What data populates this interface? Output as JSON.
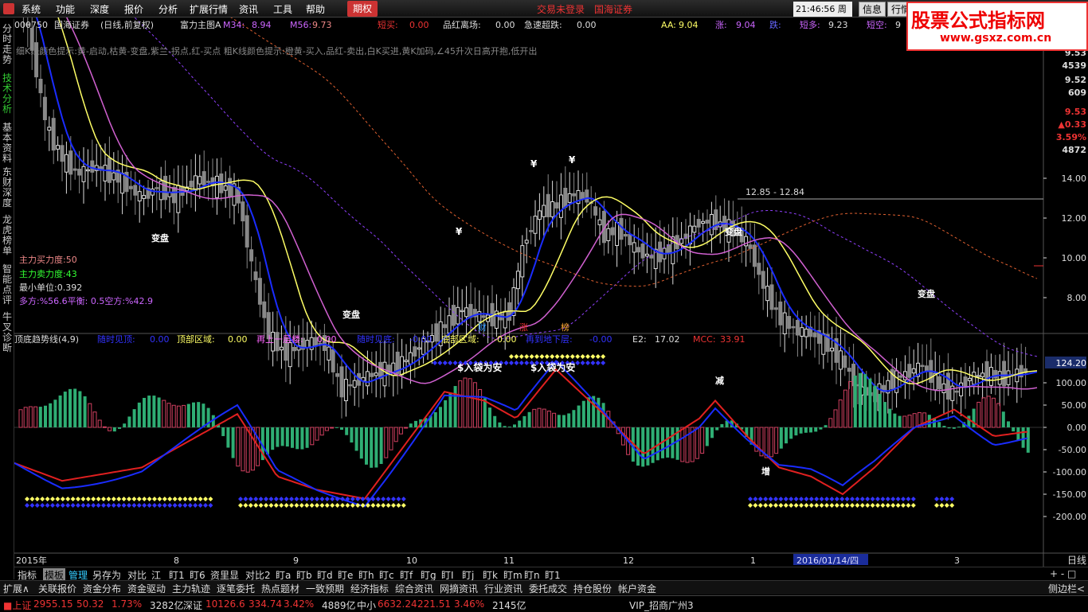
{
  "menu": {
    "items": [
      "系统",
      "功能",
      "深度",
      "报价",
      "分析",
      "扩展行情",
      "资讯",
      "工具",
      "帮助"
    ],
    "qiquan": "期权",
    "trade_status": "交易未登录",
    "broker": "国海证券",
    "time": "21:46:56 周日",
    "info": "信息",
    "market": "行情"
  },
  "watermark": {
    "title": "股票公式指标网",
    "url": "www.gsxz.com.cn"
  },
  "sidebar": {
    "tabs": [
      "分时走势",
      "技术分析",
      "基本资料",
      "东财深度",
      "龙虎榜单",
      "智能点评",
      "牛叉诊断"
    ]
  },
  "header": {
    "code": "000750",
    "name": "国海证券",
    "period": "(日线,前复权)",
    "formula": "富力主图A",
    "m34_label": "M34:",
    "m34": "8.94",
    "m56_label": "M56:",
    "m56": "9.73",
    "dm_label": "短买:",
    "dm": "0.00",
    "phlc_label": "品红离场:",
    "phlc": "0.00",
    "jscd_label": "急速超跌:",
    "jscd": "0.00",
    "aa_label": "AA:",
    "aa": "9.04",
    "zhang_label": "涨:",
    "zhang": "9.04",
    "die_label": "跌:",
    "dd_label": "短多:",
    "dd": "9.23",
    "dk_label": "短空:",
    "dk": "9"
  },
  "hint": "细K线颜色提示:黄-启动,枯黄-变盘,紫兰-拐点,红-买点 粗K线颜色提示:橙黄-买入,品红-卖出,白K买进,黄K加码,∠45升次日高开抱,低开出",
  "info_panel": {
    "buy": "主力买力度:50",
    "sell": "主力卖力度:43",
    "unit": "最小单位:0.392",
    "ratio": "多方:%56.6平衡: 0.5空方:%42.9"
  },
  "labels": {
    "bianpan": "变盘",
    "yuan": "¥",
    "range": "12.85 - 12.84",
    "cai": "财",
    "zhang": "涨",
    "bang": "榜",
    "ruidai": "$入袋为安",
    "jian": "减",
    "zeng": "增"
  },
  "right_values": [
    "9.53",
    "4539",
    "9.52",
    "609",
    "9.53",
    "▲0.33",
    "3.59%",
    "4872"
  ],
  "price_axis": [
    "14.00",
    "12.00",
    "10.00",
    "8.00"
  ],
  "lower_header": {
    "title": "顶底趋势线(4,9)",
    "sjjd_label": "随时见顶:",
    "sjjd": "0.00",
    "dbqy_label": "顶部区域:",
    "dbqy": "0.00",
    "zsyc_label": "再上一层楼:",
    "zsyc": "0.00",
    "sjjdi_label": "随时见底:",
    "sjjdi": "-0.00",
    "dbqy2_label": "底部区域:",
    "dbqy2": "-0.00",
    "ldxc_label": "再到地下层:",
    "ldxc": "-0.00",
    "e2_label": "E2:",
    "e2": "17.02",
    "mcc_label": "MCC:",
    "mcc": "33.91"
  },
  "lower_axis": [
    "100.00",
    "50.00",
    "0.00",
    "-50.00",
    "-100.00",
    "-150.00",
    "-200.00"
  ],
  "lower_current": "124.20",
  "x_axis": {
    "labels": [
      "2015年",
      "8",
      "9",
      "10",
      "11",
      "12",
      "1",
      "2016/01/14/四",
      "3"
    ],
    "right": "日线"
  },
  "tabs": [
    "指标",
    "模板",
    "管理",
    "另存为",
    "对比",
    "江",
    "盯1",
    "盯6",
    "资里显",
    "对比2",
    "盯a",
    "盯b",
    "盯d",
    "盯e",
    "盯h",
    "盯c",
    "盯f",
    "盯g",
    "盯I",
    "盯j",
    "盯k",
    "盯m",
    "盯n",
    "盯1"
  ],
  "tabs_right": "+ - □",
  "toolbar2": [
    "扩展∧",
    "关联报价",
    "资金分布",
    "资金驱动",
    "主力轨迹",
    "逐笔委托",
    "热点题材",
    "一致预期",
    "经济指标",
    "综合资讯",
    "网摘资讯",
    "行业资讯",
    "委托成交",
    "持仓股份",
    "帐户资金"
  ],
  "toolbar2_right": "侧边栏<",
  "status": {
    "sh_label": "上证",
    "sh_val": "2955.15",
    "sh_chg": "50.32",
    "sh_pct": "1.73%",
    "sh_amt": "3282亿",
    "sz_label": "深证",
    "sz_val": "10126.6",
    "sz_chg": "334.74",
    "sz_pct": "3.42%",
    "sz_amt": "4889亿",
    "zx_label": "中小",
    "zx_val": "6632.24",
    "zx_chg": "221.51",
    "zx_pct": "3.46%",
    "zx_amt": "2145亿",
    "vip": "VIP_招商广州3"
  },
  "colors": {
    "up": "#e33",
    "down": "#3c3",
    "ma_blue": "#1a2cff",
    "ma_yellow": "#ffff66",
    "ma_magenta": "#d060d0",
    "lower_red": "#e02020",
    "lower_blue": "#1a2cff"
  }
}
